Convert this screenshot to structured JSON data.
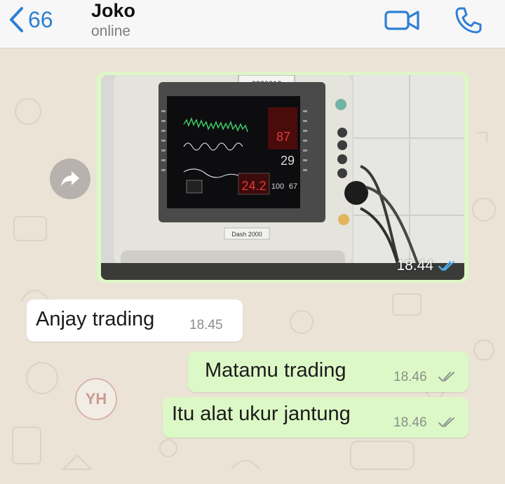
{
  "header": {
    "back_count": "66",
    "contact_name": "Joko",
    "contact_status": "online",
    "icons": [
      "chevron-left-icon",
      "video-call-icon",
      "phone-icon"
    ],
    "accent_color": "#2f7fd4"
  },
  "messages": [
    {
      "direction": "outgoing",
      "type": "image",
      "time": "18.44",
      "status": "read",
      "image": {
        "monitor_label": "6320018",
        "brand_label": "Dash 2000",
        "readings": [
          "87",
          "29",
          "24.2",
          "100",
          "67"
        ]
      }
    },
    {
      "direction": "incoming",
      "type": "text",
      "text": "Anjay trading",
      "time": "18.45"
    },
    {
      "direction": "outgoing",
      "type": "text",
      "text": "Matamu trading",
      "time": "18.46",
      "status": "delivered"
    },
    {
      "direction": "outgoing",
      "type": "text",
      "text": "Itu alat ukur jantung",
      "time": "18.46",
      "status": "delivered"
    }
  ],
  "colors": {
    "outgoing_bubble": "#dcf8c6",
    "incoming_bubble": "#ffffff",
    "chat_background": "#ebe3d6",
    "read_tick": "#4fb3f6"
  }
}
